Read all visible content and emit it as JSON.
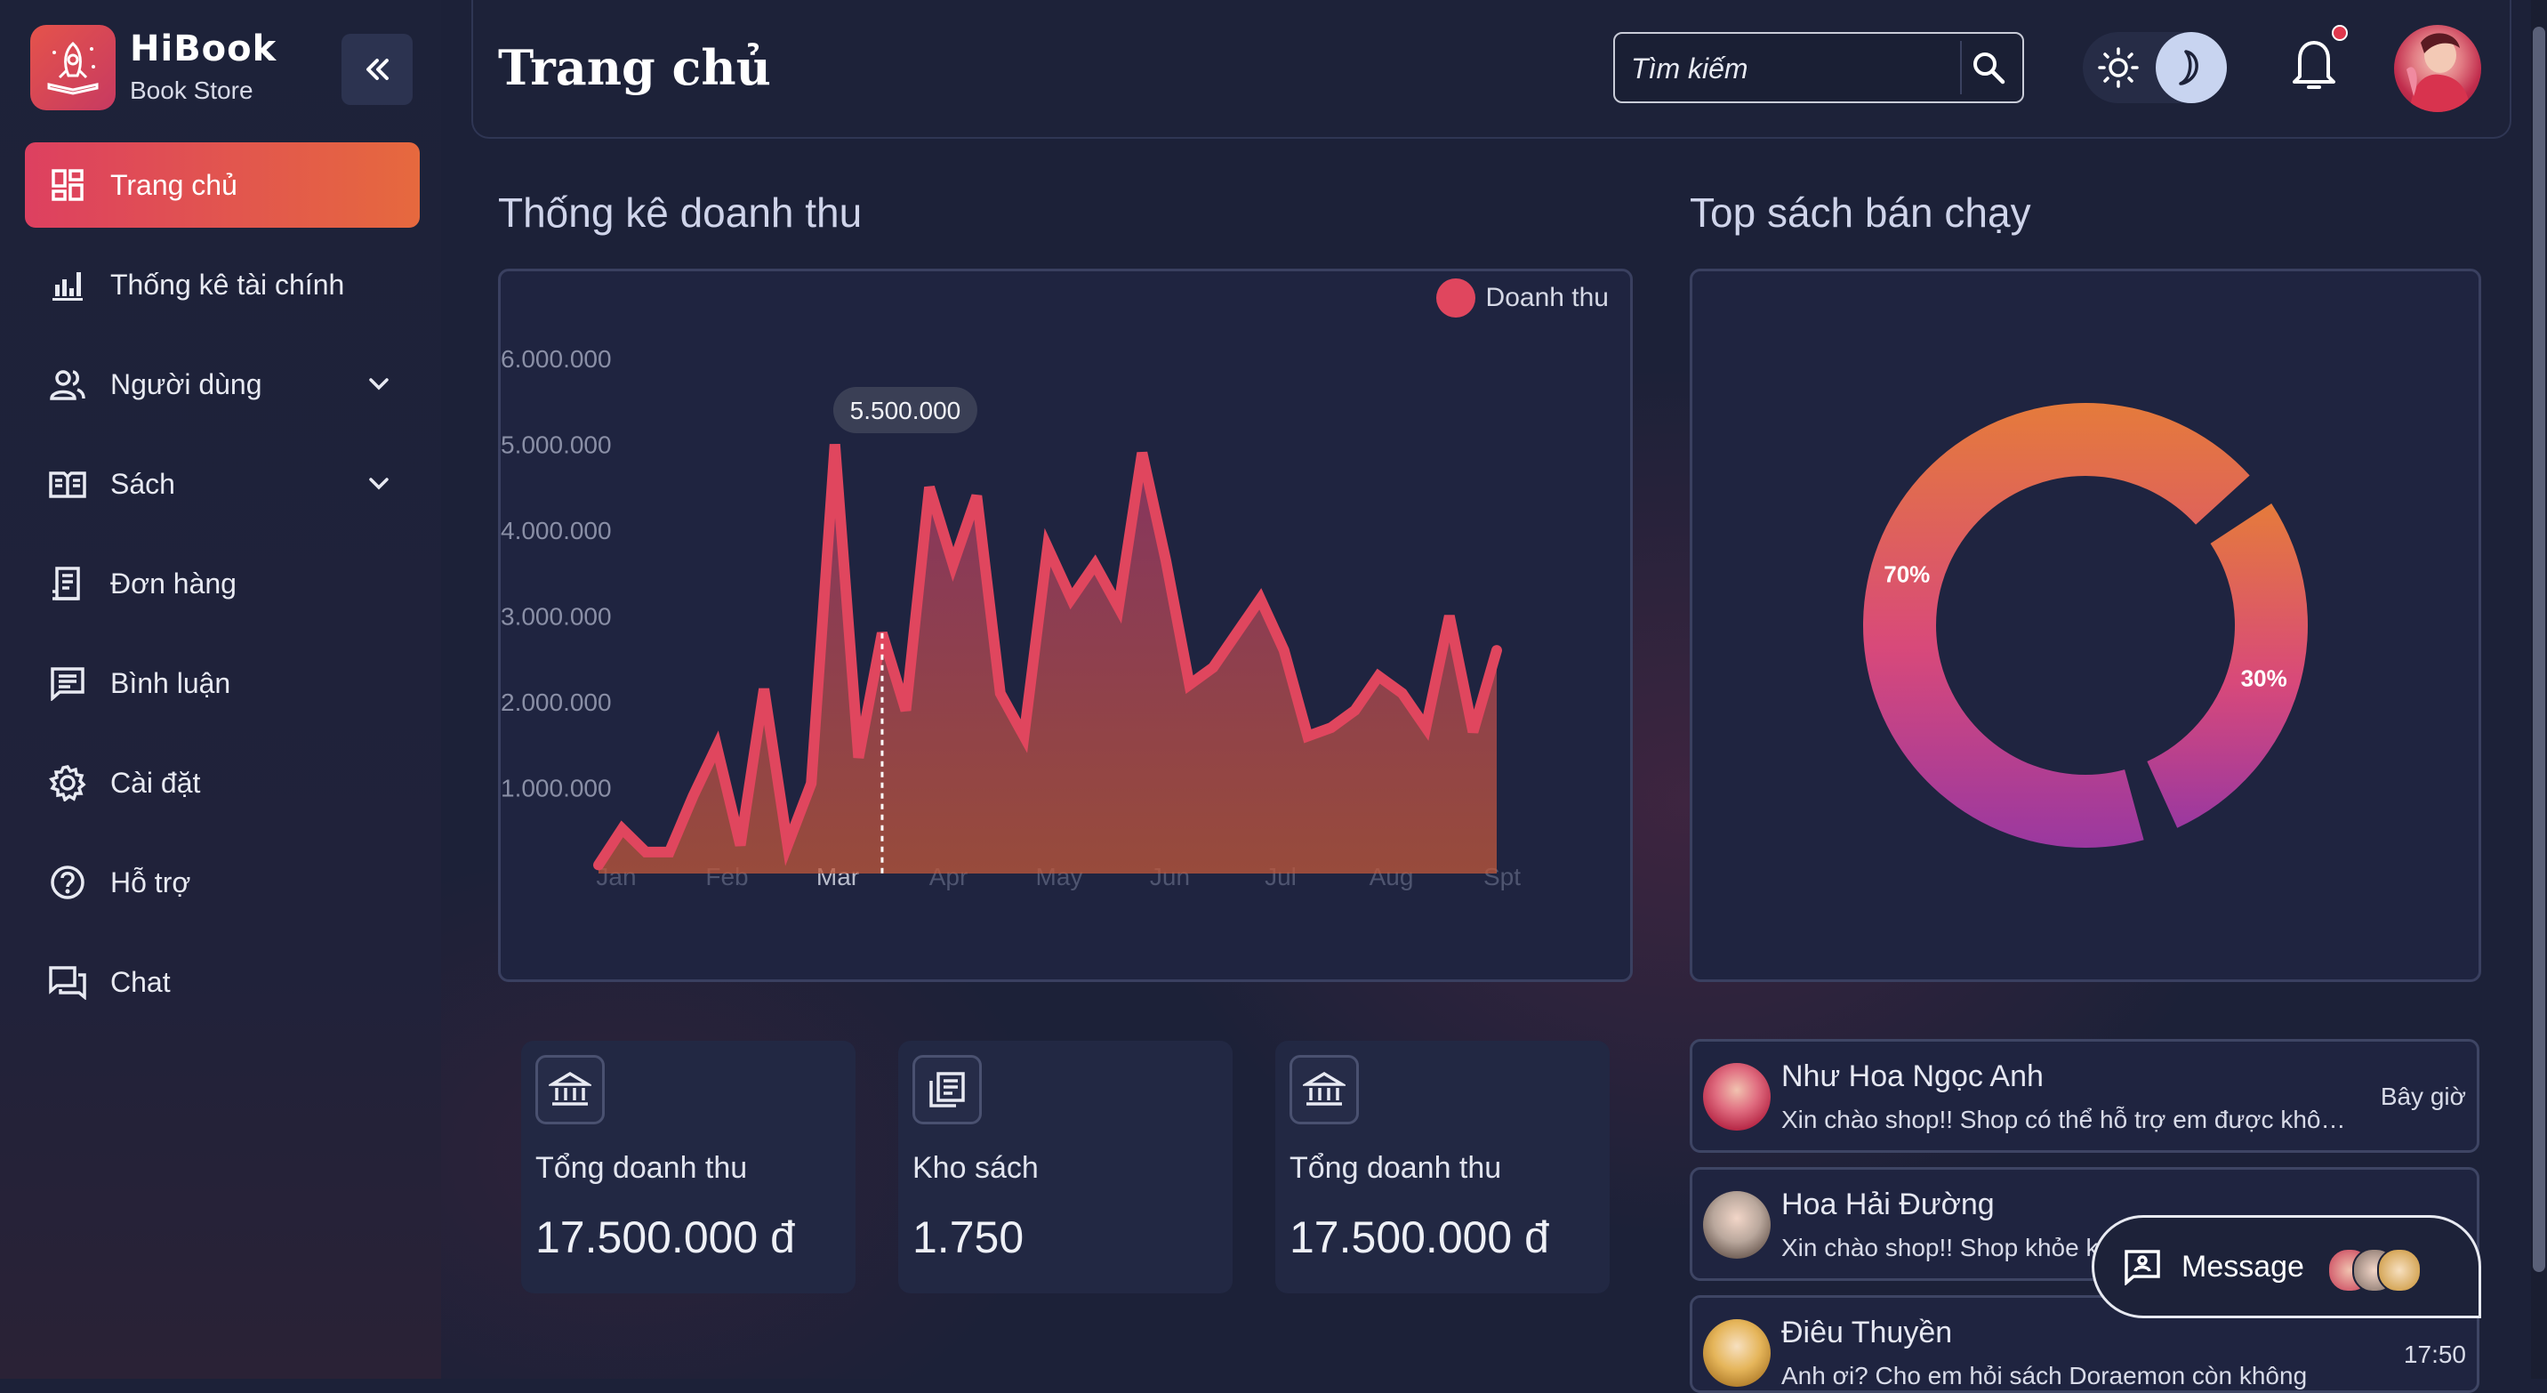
{
  "brand": {
    "name": "HiBook",
    "subtitle": "Book Store"
  },
  "sidebar": {
    "items": [
      {
        "label": "Trang chủ",
        "icon": "dashboard-icon",
        "active": true
      },
      {
        "label": "Thống kê tài chính",
        "icon": "bar-chart-icon"
      },
      {
        "label": "Người dùng",
        "icon": "users-icon",
        "expandable": true
      },
      {
        "label": "Sách",
        "icon": "book-open-icon",
        "expandable": true
      },
      {
        "label": "Đơn hàng",
        "icon": "receipt-icon"
      },
      {
        "label": "Bình luận",
        "icon": "comment-icon"
      },
      {
        "label": "Cài đặt",
        "icon": "gear-icon"
      },
      {
        "label": "Hỗ trợ",
        "icon": "help-icon"
      },
      {
        "label": "Chat",
        "icon": "chat-icon"
      }
    ]
  },
  "header": {
    "title": "Trang chủ",
    "search_placeholder": "Tìm kiếm"
  },
  "revenue": {
    "title": "Thống kê doanh thu",
    "tooltip": "5.500.000"
  },
  "top_books": {
    "title": "Top sách bán chạy"
  },
  "stats": [
    {
      "label": "Tổng doanh thu",
      "value": "17.500.000 đ",
      "icon": "bank-icon"
    },
    {
      "label": "Kho sách",
      "value": "1.750",
      "icon": "library-icon"
    },
    {
      "label": "Tổng doanh thu",
      "value": "17.500.000 đ",
      "icon": "bank-icon"
    }
  ],
  "messages": [
    {
      "name": "Như Hoa Ngọc Anh",
      "text": "Xin chào shop!! Shop có thể hỗ trợ em được khôn...",
      "time": "Bây giờ"
    },
    {
      "name": "Hoa Hải Đường",
      "text": "Xin chào shop!! Shop khỏe không",
      "time": ""
    },
    {
      "name": "Điêu Thuyền",
      "text": "Anh ơi? Cho em hỏi sách Doraemon còn không",
      "time": "17:50"
    }
  ],
  "message_button": {
    "label": "Message"
  },
  "colors": {
    "accent_start": "#dd4060",
    "accent_end": "#e6693e",
    "line": "#e0465e",
    "background": "#1c2138"
  },
  "chart_data": [
    {
      "type": "area",
      "series": [
        {
          "name": "Doanh thu",
          "values": [
            0.1,
            0.52,
            0.25,
            0.25,
            0.9,
            1.48,
            0.33,
            2.15,
            0.33,
            1.05,
            5.0,
            1.35,
            2.8,
            1.9,
            4.5,
            3.6,
            4.4,
            2.1,
            1.6,
            3.8,
            3.2,
            3.6,
            3.1,
            4.9,
            3.65,
            2.2,
            2.4,
            2.8,
            3.2,
            2.6,
            1.6,
            1.7,
            1.9,
            2.3,
            2.1,
            1.7,
            3.0,
            1.65,
            2.6
          ]
        }
      ],
      "categories": [
        "Jan",
        "Feb",
        "Mar",
        "Apr",
        "May",
        "Jun",
        "Jul",
        "Aug",
        "Spt"
      ],
      "ytick_labels": [
        "1.000.000",
        "2.000.000",
        "3.000.000",
        "4.000.000",
        "5.000.000",
        "6.000.000"
      ],
      "yticks": [
        1,
        2,
        3,
        4,
        5,
        6
      ],
      "ylim": [
        0.0,
        6.5
      ],
      "highlight_category": "Mar",
      "tooltip_value": "5.500.000",
      "legend_position": "top-right"
    },
    {
      "type": "pie",
      "labels": [
        "70%",
        "30%"
      ],
      "values": [
        70,
        30
      ],
      "donut": true
    }
  ]
}
